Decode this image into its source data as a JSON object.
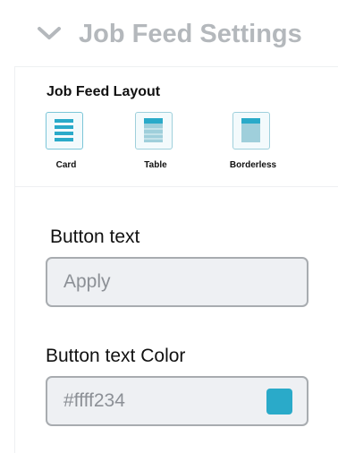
{
  "header": {
    "title": "Job Feed Settings",
    "chevron_icon": "chevron-down-icon"
  },
  "layout": {
    "title": "Job Feed Layout",
    "options": [
      {
        "label": "Card",
        "icon": "card-layout-icon",
        "selected": true
      },
      {
        "label": "Table",
        "icon": "table-layout-icon",
        "selected": false
      },
      {
        "label": "Borderless",
        "icon": "borderless-layout-icon",
        "selected": false
      }
    ]
  },
  "button_text": {
    "label": "Button text",
    "value": "Apply"
  },
  "button_text_color": {
    "label": "Button text Color",
    "value": "#ffff234",
    "swatch_color": "#2aaac9"
  },
  "colors": {
    "accent": "#2aaac9",
    "muted_title": "#b4b8bc",
    "input_bg": "#eef0f3",
    "input_border": "#a8acb0"
  }
}
